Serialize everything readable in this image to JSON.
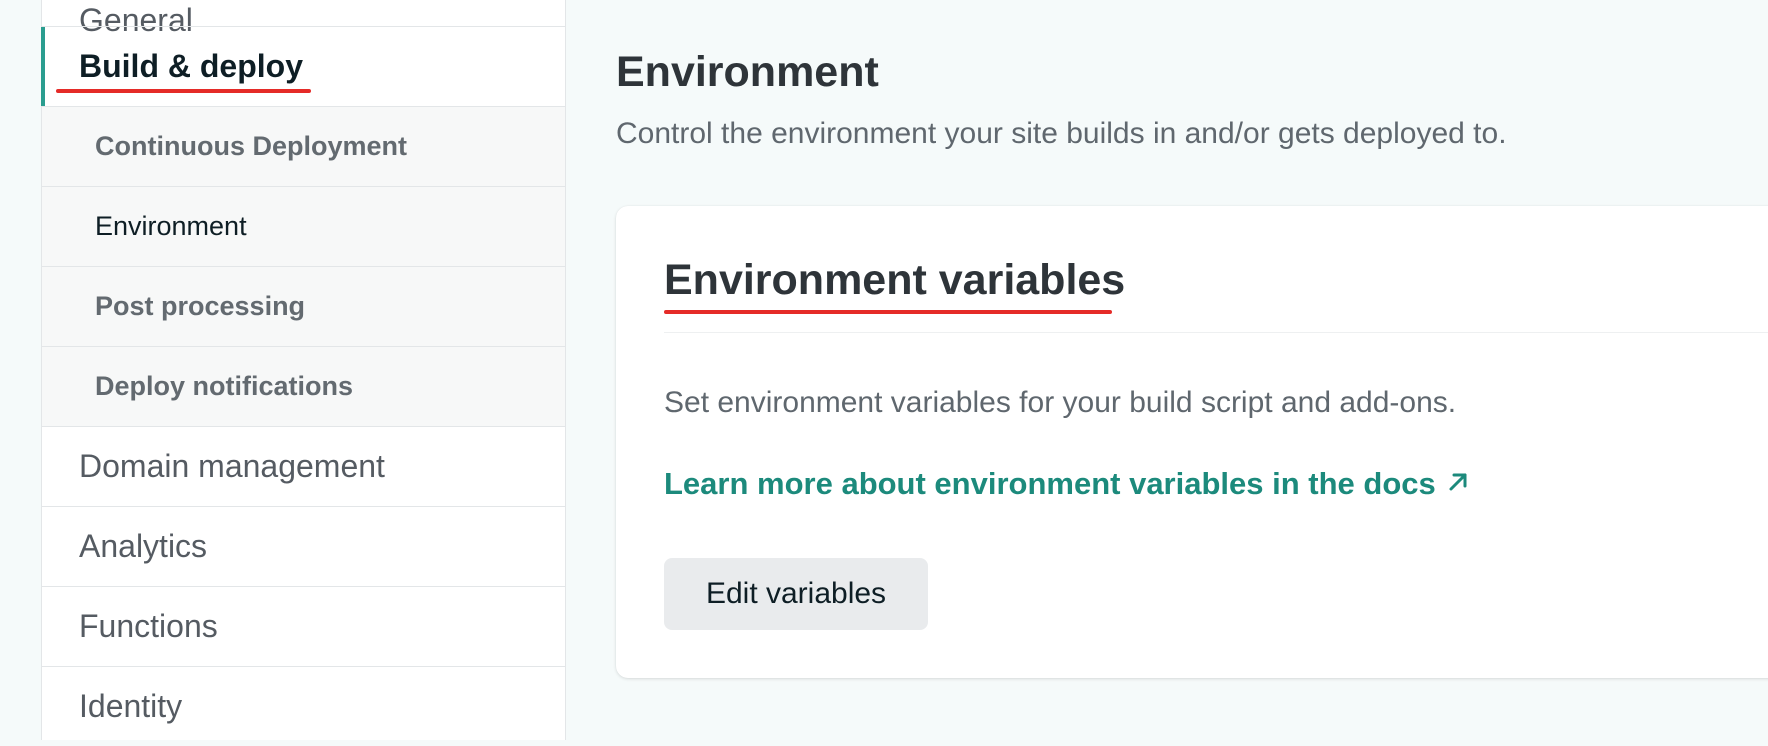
{
  "sidebar": {
    "items": [
      {
        "label": "General"
      },
      {
        "label": "Build & deploy"
      },
      {
        "label": "Continuous Deployment"
      },
      {
        "label": "Environment"
      },
      {
        "label": "Post processing"
      },
      {
        "label": "Deploy notifications"
      },
      {
        "label": "Domain management"
      },
      {
        "label": "Analytics"
      },
      {
        "label": "Functions"
      },
      {
        "label": "Identity"
      }
    ]
  },
  "main": {
    "title": "Environment",
    "subtitle": "Control the environment your site builds in and/or gets deployed to.",
    "card": {
      "title": "Environment variables",
      "description": "Set environment variables for your build script and add-ons.",
      "link_label": "Learn more about environment variables in the docs",
      "link_icon": "external-arrow-icon",
      "button_label": "Edit variables"
    }
  },
  "colors": {
    "accent": "#2a9d8f",
    "link": "#1c8a7c",
    "annotation": "#e52b28"
  }
}
